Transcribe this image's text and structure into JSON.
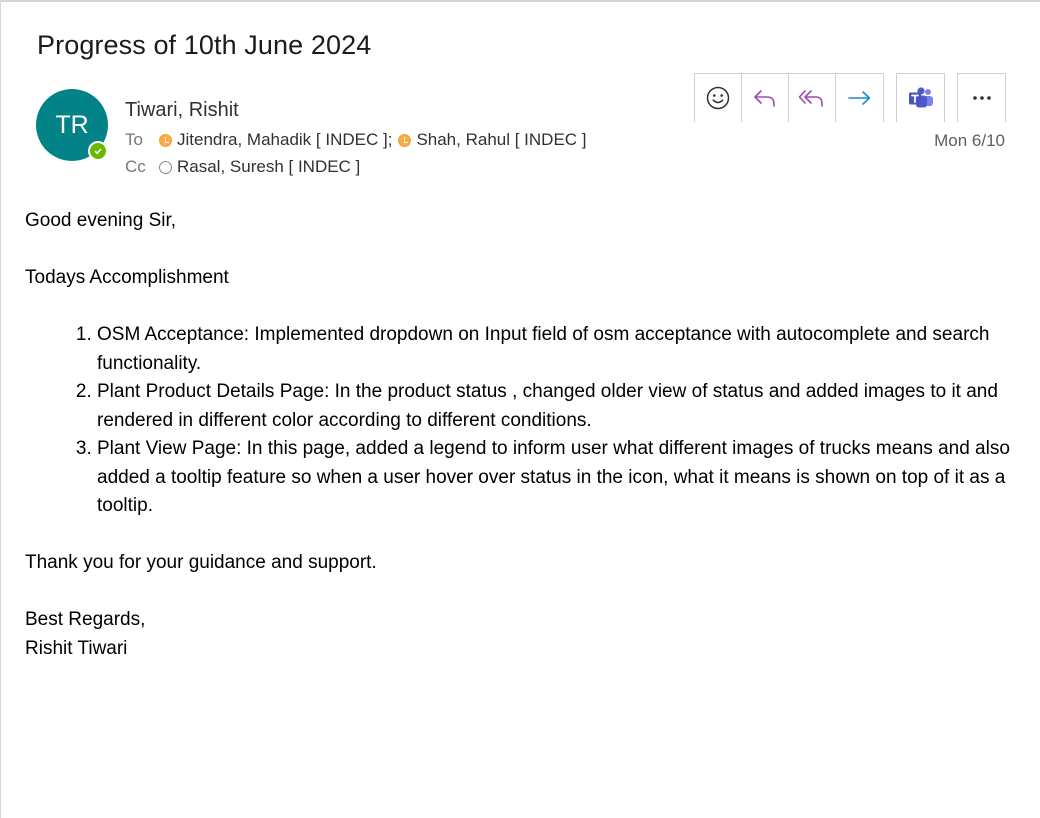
{
  "email": {
    "subject": "Progress of 10th June 2024",
    "avatar_initials": "TR",
    "avatar_color": "#038387",
    "sender": "Tiwari, Rishit",
    "date": "Mon 6/10",
    "to_label": "To",
    "cc_label": "Cc",
    "to": [
      {
        "name": "Jitendra, Mahadik [ INDEC ]",
        "separator": ";",
        "status": "away"
      },
      {
        "name": "Shah, Rahul [ INDEC ]",
        "separator": "",
        "status": "away"
      }
    ],
    "cc": [
      {
        "name": "Rasal, Suresh [ INDEC ]",
        "status": "offline"
      }
    ]
  },
  "toolbar": {
    "icons": [
      "emoji-icon",
      "reply-icon",
      "reply-all-icon",
      "forward-icon",
      "teams-icon",
      "more-icon"
    ]
  },
  "body": {
    "greeting": "Good evening Sir,",
    "heading": "Todays Accomplishment",
    "items": [
      "OSM Acceptance: Implemented dropdown on Input field of osm acceptance with autocomplete and search functionality.",
      "Plant Product Details Page: In the product status , changed older view of status and added images to it and rendered in different color according to different conditions.",
      "Plant View Page: In this page, added a legend to inform user what different images of trucks means and also added a tooltip feature so when a user hover over status in the icon, what it means is shown on top of it as a tooltip."
    ],
    "thanks": "Thank you for your guidance and support.",
    "closing": "Best Regards,",
    "signature": "Rishit Tiwari"
  }
}
